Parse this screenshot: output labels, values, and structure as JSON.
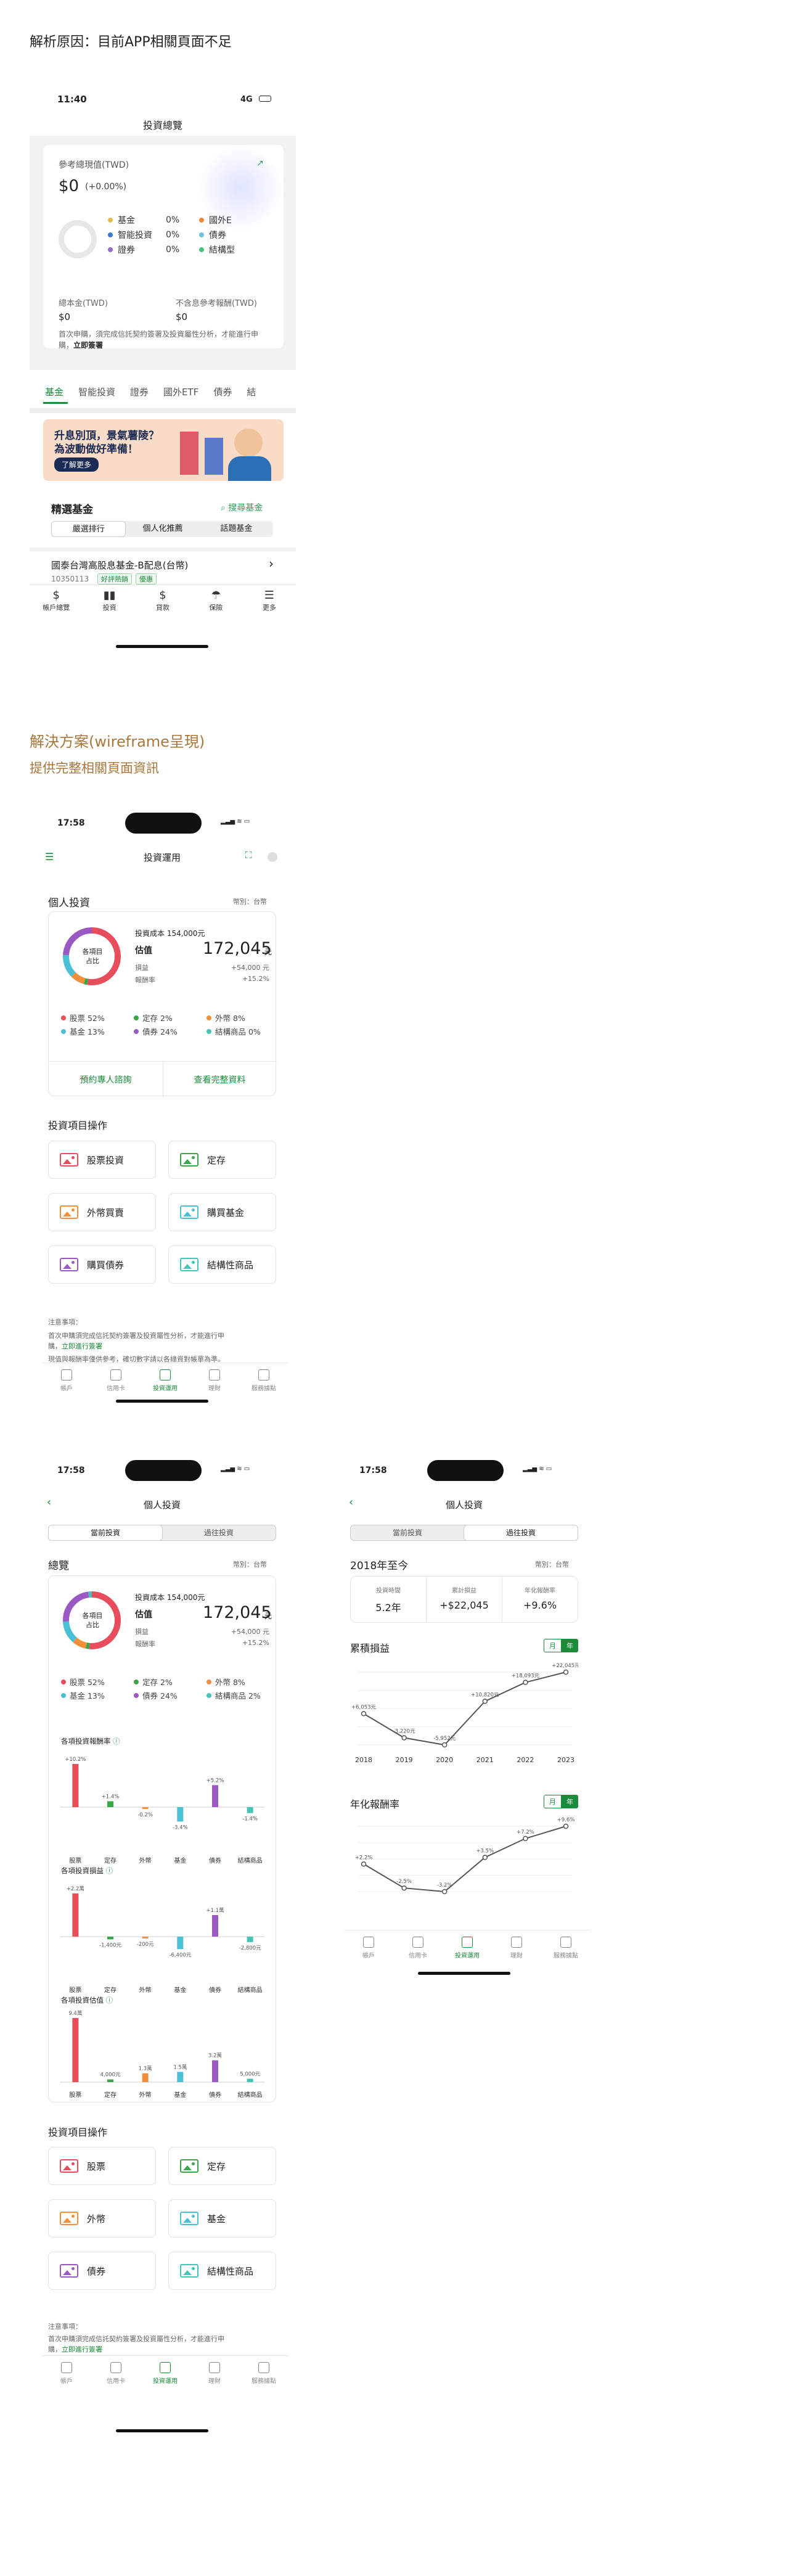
{
  "section1": {
    "title": "解析原因：目前APP相關頁面不足"
  },
  "old_app": {
    "time": "11:40",
    "network": "4G",
    "title": "投資總覽",
    "ref_label": "參考總現值(TWD)",
    "ref_value": "$0",
    "ref_change": "(+0.00%)",
    "legend": [
      {
        "name": "基金",
        "pct": "0%",
        "color": "#e8b84a"
      },
      {
        "name": "國外E",
        "pct": "",
        "color": "#f08a3a"
      },
      {
        "name": "智能投資",
        "pct": "0%",
        "color": "#3a7bd5"
      },
      {
        "name": "債券",
        "pct": "",
        "color": "#6cc0e0"
      },
      {
        "name": "證券",
        "pct": "0%",
        "color": "#9b6ad0"
      },
      {
        "name": "結構型",
        "pct": "",
        "color": "#4cbf7a"
      }
    ],
    "principal_label": "總本金(TWD)",
    "principal_value": "$0",
    "pl_label": "不含息參考報酬(TWD)",
    "pl_value": "$0",
    "note": "首次申購，須完成信託契約簽署及投資屬性分析，才能進行申購，",
    "note_link": "立即簽署",
    "tabs": [
      "基金",
      "智能投資",
      "證券",
      "國外ETF",
      "債券",
      "結"
    ],
    "banner_line1": "升息別頂，景氣薯陵？",
    "banner_line2": "為波動做好準備！",
    "banner_btn": "了解更多",
    "featured_title": "精選基金",
    "search_fund": "搜尋基金",
    "filters": [
      "嚴選排行",
      "個人化推薦",
      "話題基金"
    ],
    "fund_name": "國泰台灣高股息基金-B配息(台幣)",
    "fund_code": "10350113",
    "fund_tags": [
      "好評熱銷",
      "優惠"
    ],
    "bottom_tabs": [
      "帳戶總覽",
      "投資",
      "貸款",
      "保險",
      "更多"
    ]
  },
  "solution": {
    "title": "解決方案(wireframe呈現)",
    "subtitle": "提供完整相關頁面資訊"
  },
  "phone1": {
    "time": "17:58",
    "title": "投資運用",
    "section": "個人投資",
    "currency": "幣別：台幣",
    "donut_center": "各項目\n占比",
    "cost_label": "投資成本 154,000元",
    "est_label": "估值",
    "est_value": "172,045",
    "unit": "元",
    "pl_label": "損益",
    "pl_value": "+54,000 元",
    "rr_label": "報酬率",
    "rr_value": "+15.2%",
    "legend": [
      {
        "name": "股票 52%",
        "color": "#e84d5b"
      },
      {
        "name": "定存 2%",
        "color": "#3aa84a"
      },
      {
        "name": "外幣 8%",
        "color": "#f0903a"
      },
      {
        "name": "基金 13%",
        "color": "#4bbfd4"
      },
      {
        "name": "債券 24%",
        "color": "#9b59c4"
      },
      {
        "name": "結構商品 0%",
        "color": "#45c4b8"
      }
    ],
    "btn_consult": "預約專人諮詢",
    "btn_detail": "查看完整資料",
    "ops_title": "投資項目操作",
    "ops": [
      {
        "label": "股票投資",
        "color": "#e84d5b"
      },
      {
        "label": "定存",
        "color": "#3aa84a"
      },
      {
        "label": "外幣買賣",
        "color": "#f0903a"
      },
      {
        "label": "購買基金",
        "color": "#4bbfd4"
      },
      {
        "label": "購買債券",
        "color": "#9b59c4"
      },
      {
        "label": "結構性商品",
        "color": "#45c4b8"
      }
    ],
    "note_title": "注意事項：",
    "note_line": "首次申購須完成信託契約簽署及投資屬性分析，才能進行申",
    "note_line2": "購，",
    "note_link": "立即進行簽署",
    "note_line3": "現值與報酬率僅供參考，確切數字請以各總資對帳單為準。",
    "bottom_tabs": [
      "帳戶",
      "信用卡",
      "投資運用",
      "理財",
      "服務據點"
    ]
  },
  "phone2": {
    "time": "17:58",
    "title": "個人投資",
    "seg": [
      "當前投資",
      "過往投資"
    ],
    "section": "總覽",
    "currency": "幣別：台幣",
    "cost_label": "投資成本 154,000元",
    "est_label": "估值",
    "est_value": "172,045",
    "unit": "元",
    "pl_label": "損益",
    "pl_value": "+54,000 元",
    "rr_label": "報酬率",
    "rr_value": "+15.2%",
    "donut_center": "各項目\n占比",
    "legend": [
      {
        "name": "股票 52%",
        "color": "#e84d5b"
      },
      {
        "name": "定存 2%",
        "color": "#3aa84a"
      },
      {
        "name": "外幣 8%",
        "color": "#f0903a"
      },
      {
        "name": "基金 13%",
        "color": "#4bbfd4"
      },
      {
        "name": "債券 24%",
        "color": "#9b59c4"
      },
      {
        "name": "結構商品 2%",
        "color": "#45c4b8"
      }
    ],
    "chart1_title": "各項投資報酬率",
    "chart2_title": "各項投資損益",
    "chart3_title": "各項投資估值",
    "categories": [
      "股票",
      "定存",
      "外幣",
      "基金",
      "債券",
      "結構商品"
    ],
    "ops_title": "投資項目操作",
    "ops": [
      {
        "label": "股票",
        "color": "#e84d5b"
      },
      {
        "label": "定存",
        "color": "#3aa84a"
      },
      {
        "label": "外幣",
        "color": "#f0903a"
      },
      {
        "label": "基金",
        "color": "#4bbfd4"
      },
      {
        "label": "債券",
        "color": "#9b59c4"
      },
      {
        "label": "結構性商品",
        "color": "#45c4b8"
      }
    ],
    "note_title": "注意事項：",
    "note_line": "首次申購須完成信託契約簽署及投資屬性分析，才能進行申",
    "note_line2": "購，",
    "note_link": "立即進行簽署",
    "bottom_tabs": [
      "帳戶",
      "信用卡",
      "投資運用",
      "理財",
      "服務據點"
    ]
  },
  "phone3": {
    "time": "17:58",
    "title": "個人投資",
    "seg": [
      "當前投資",
      "過往投資"
    ],
    "period": "2018年至今",
    "currency": "幣別：台幣",
    "stats": [
      {
        "label": "投資時間",
        "value": "5.2年"
      },
      {
        "label": "累計損益",
        "value": "+$22,045"
      },
      {
        "label": "年化報酬率",
        "value": "+9.6%"
      }
    ],
    "cum_title": "累積損益",
    "ann_title": "年化報酬率",
    "toggle": [
      "月",
      "年"
    ],
    "bottom_tabs": [
      "帳戶",
      "信用卡",
      "投資運用",
      "理財",
      "服務據點"
    ]
  },
  "chart_data": [
    {
      "type": "bar",
      "title": "各項投資報酬率",
      "categories": [
        "股票",
        "定存",
        "外幣",
        "基金",
        "債券",
        "結構商品"
      ],
      "values": [
        10.2,
        1.4,
        -0.2,
        -3.4,
        5.2,
        -1.4
      ],
      "labels": [
        "+10.2%",
        "+1.4%",
        "-0.2%",
        "-3.4%",
        "+5.2%",
        "-1.4%"
      ],
      "colors": [
        "#e84d5b",
        "#3aa84a",
        "#f0903a",
        "#4bbfd4",
        "#9b59c4",
        "#45c4b8"
      ]
    },
    {
      "type": "bar",
      "title": "各項投資損益",
      "categories": [
        "股票",
        "定存",
        "外幣",
        "基金",
        "債券",
        "結構商品"
      ],
      "values": [
        22000,
        -1400,
        -200,
        -6400,
        11000,
        -2800
      ],
      "labels": [
        "+2.2萬",
        "-1,400元",
        "-200元",
        "-6,400元",
        "+1.1萬",
        "-2,800元"
      ],
      "colors": [
        "#e84d5b",
        "#3aa84a",
        "#f0903a",
        "#4bbfd4",
        "#9b59c4",
        "#45c4b8"
      ]
    },
    {
      "type": "bar",
      "title": "各項投資估值",
      "categories": [
        "股票",
        "定存",
        "外幣",
        "基金",
        "債券",
        "結構商品"
      ],
      "values": [
        94000,
        4000,
        13000,
        15000,
        32000,
        5000
      ],
      "labels": [
        "9.4萬",
        "4,000元",
        "1.3萬",
        "1.5萬",
        "3.2萬",
        "5,000元"
      ],
      "colors": [
        "#e84d5b",
        "#3aa84a",
        "#f0903a",
        "#4bbfd4",
        "#9b59c4",
        "#45c4b8"
      ]
    },
    {
      "type": "line",
      "title": "累積損益",
      "x": [
        "2018",
        "2019",
        "2020",
        "2021",
        "2022",
        "2023"
      ],
      "values": [
        6053,
        -3220,
        -5952,
        10820,
        18093,
        22045
      ],
      "labels": [
        "+6,053元",
        "-3,220元",
        "-5,952元",
        "+10,820元",
        "+18,093元",
        "+22,045元"
      ]
    },
    {
      "type": "line",
      "title": "年化報酬率",
      "values": [
        2.2,
        -2.5,
        -3.2,
        3.5,
        7.2,
        9.6
      ],
      "labels": [
        "+2.2%",
        "-2.5%",
        "-3.2%",
        "+3.5%",
        "+7.2%",
        "+9.6%"
      ]
    }
  ]
}
